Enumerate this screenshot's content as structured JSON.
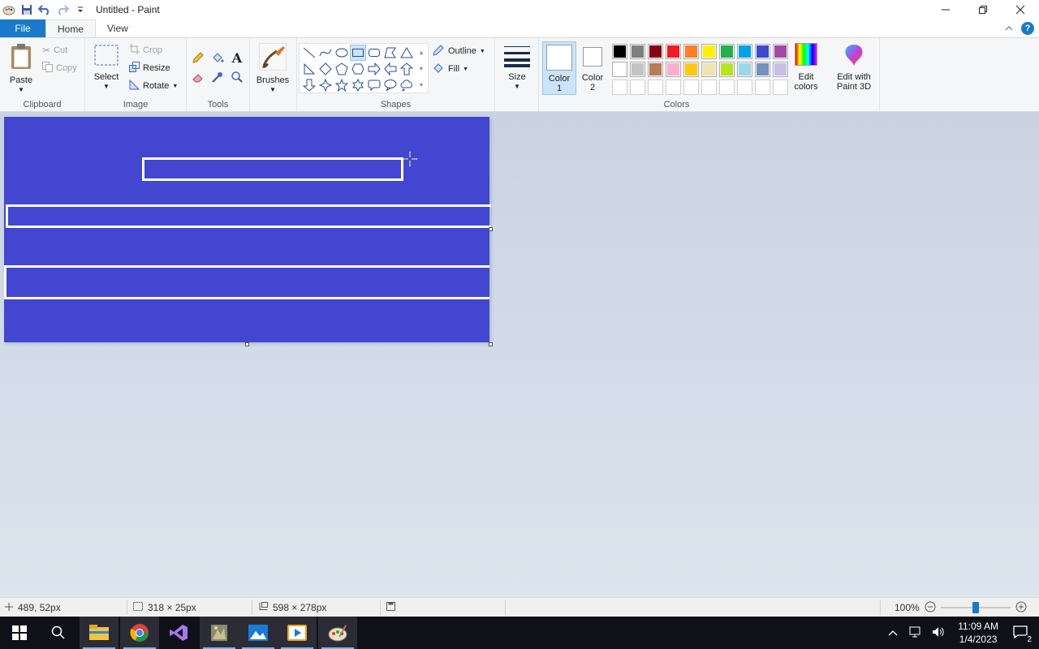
{
  "window": {
    "title": "Untitled - Paint"
  },
  "tabs": {
    "file": "File",
    "home": "Home",
    "view": "View"
  },
  "clipboard": {
    "paste": "Paste",
    "cut": "Cut",
    "copy": "Copy",
    "label": "Clipboard"
  },
  "image": {
    "select": "Select",
    "crop": "Crop",
    "resize": "Resize",
    "rotate": "Rotate",
    "label": "Image"
  },
  "tools": {
    "label": "Tools"
  },
  "brushes": {
    "label": "Brushes"
  },
  "shapes": {
    "outline": "Outline",
    "fill": "Fill",
    "label": "Shapes"
  },
  "size": {
    "label": "Size"
  },
  "colors": {
    "color1_line1": "Color",
    "color1_line2": "1",
    "color2_line1": "Color",
    "color2_line2": "2",
    "edit_line1": "Edit",
    "edit_line2": "colors",
    "paint3d_line1": "Edit with",
    "paint3d_line2": "Paint 3D",
    "label": "Colors",
    "palette_row1": [
      "#000000",
      "#7f7f7f",
      "#880015",
      "#ed1c24",
      "#ff7f27",
      "#fff200",
      "#22b14c",
      "#00a2e8",
      "#3f48cc",
      "#a349a4"
    ],
    "palette_row2": [
      "#ffffff",
      "#c3c3c3",
      "#b97a57",
      "#ffaec9",
      "#ffc90e",
      "#efe4b0",
      "#b5e61d",
      "#99d9ea",
      "#7092be",
      "#c8bfe7"
    ],
    "canvas_fill": "#4246d0"
  },
  "status": {
    "cursor_pos": "489, 52px",
    "selection_size": "318 × 25px",
    "canvas_size": "598 × 278px",
    "zoom": "100%"
  },
  "taskbar": {
    "time": "11:09 AM",
    "date": "1/4/2023",
    "notifications": "2"
  }
}
